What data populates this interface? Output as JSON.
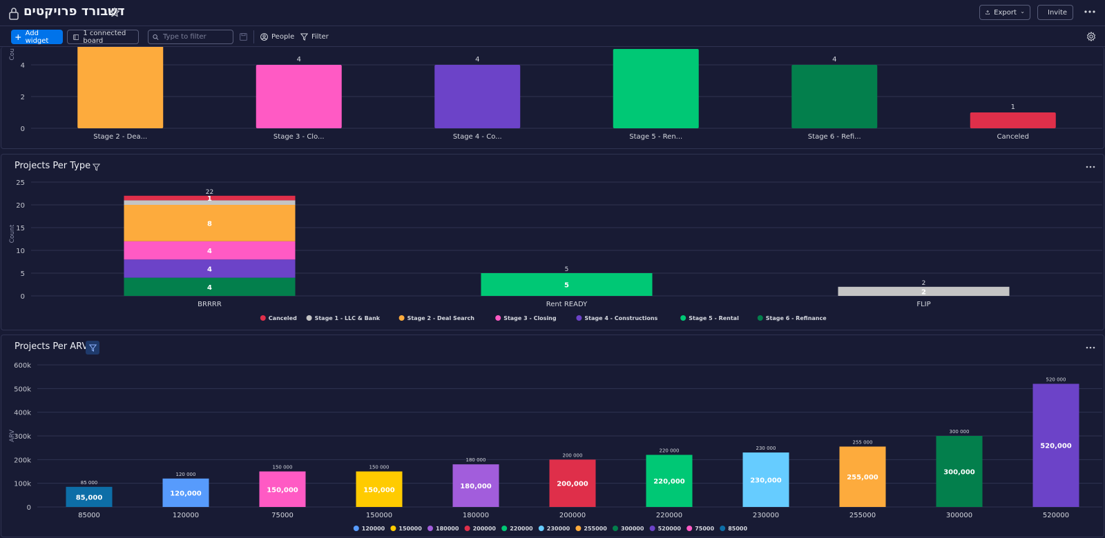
{
  "header": {
    "title": "דשבורד פרויקטים",
    "export_label": "Export",
    "invite_label": "Invite"
  },
  "toolbar": {
    "add_widget_label": "Add widget",
    "connected_board_label": "1 connected board",
    "filter_placeholder": "Type to filter",
    "people_label": "People",
    "filter_label": "Filter"
  },
  "colors": {
    "Stage 1 - LLC & Bank": "#c4c4c4",
    "Stage 2 - Deal Search": "#fdab3d",
    "Stage 3 - Closing": "#ff5ac4",
    "Stage 4 - Constructions": "#6c43c8",
    "Stage 5 - Rental": "#00c875",
    "Stage 6 - Refinance": "#037f4c",
    "Canceled": "#df2f4a"
  },
  "panels": {
    "per_type_title": "Projects Per Type",
    "per_arv_title": "Projects Per ARV"
  },
  "chart_data": [
    {
      "type": "bar",
      "ylabel": "Cou",
      "y_ticks": [
        0,
        2,
        4
      ],
      "categories": [
        "Stage 2 - Dea...",
        "Stage 3 - Clo...",
        "Stage 4 - Co...",
        "Stage 5 - Ren...",
        "Stage 6 - Refi...",
        "Canceled"
      ],
      "values": [
        6,
        4,
        4,
        5,
        4,
        1
      ],
      "value_labels": [
        "",
        "4",
        "4",
        "",
        "4",
        "1"
      ],
      "colors": [
        "#fdab3d",
        "#ff5ac4",
        "#6c43c8",
        "#00c875",
        "#037f4c",
        "#df2f4a"
      ]
    },
    {
      "type": "bar",
      "stacked": true,
      "ylabel": "Count",
      "ylim": [
        0,
        25
      ],
      "y_ticks": [
        0,
        5,
        10,
        15,
        20,
        25
      ],
      "categories": [
        "BRRRR",
        "Rent READY",
        "FLIP"
      ],
      "totals": [
        "22",
        "5",
        "2"
      ],
      "series": [
        {
          "name": "Stage 6 - Refinance",
          "color": "#037f4c",
          "values": [
            4,
            0,
            0
          ]
        },
        {
          "name": "Stage 4 - Constructions",
          "color": "#6c43c8",
          "values": [
            4,
            0,
            0
          ]
        },
        {
          "name": "Stage 3 - Closing",
          "color": "#ff5ac4",
          "values": [
            4,
            0,
            0
          ]
        },
        {
          "name": "Stage 2 - Deal Search",
          "color": "#fdab3d",
          "values": [
            8,
            0,
            0
          ]
        },
        {
          "name": "Stage 1 - LLC & Bank",
          "color": "#c4c4c4",
          "values": [
            1,
            0,
            2
          ]
        },
        {
          "name": "Canceled",
          "color": "#df2f4a",
          "values": [
            1,
            0,
            0
          ]
        },
        {
          "name": "Stage 5 - Rental",
          "color": "#00c875",
          "values": [
            0,
            5,
            0
          ]
        }
      ],
      "segment_labels": [
        [
          "4",
          "",
          ""
        ],
        [
          "4",
          "",
          ""
        ],
        [
          "4",
          "",
          ""
        ],
        [
          "8",
          "",
          ""
        ],
        [
          "",
          "",
          "2"
        ],
        [
          "1",
          "",
          ""
        ],
        [
          "",
          "5",
          ""
        ]
      ],
      "legend": [
        {
          "name": "Canceled",
          "color": "#df2f4a"
        },
        {
          "name": "Stage 1 - LLC & Bank",
          "color": "#c4c4c4"
        },
        {
          "name": "Stage 2 - Deal Search",
          "color": "#fdab3d"
        },
        {
          "name": "Stage 3 - Closing",
          "color": "#ff5ac4"
        },
        {
          "name": "Stage 4 - Constructions",
          "color": "#6c43c8"
        },
        {
          "name": "Stage 5 - Rental",
          "color": "#00c875"
        },
        {
          "name": "Stage 6 - Refinance",
          "color": "#037f4c"
        }
      ]
    },
    {
      "type": "bar",
      "ylabel": "ARV",
      "ylim": [
        0,
        600000
      ],
      "y_ticks": [
        0,
        100000,
        200000,
        300000,
        400000,
        500000,
        600000
      ],
      "y_tick_labels": [
        "0",
        "100k",
        "200k",
        "300k",
        "400k",
        "500k",
        "600k"
      ],
      "categories": [
        "85000",
        "120000",
        "75000",
        "150000",
        "180000",
        "200000",
        "220000",
        "230000",
        "255000",
        "300000",
        "520000"
      ],
      "values": [
        85000,
        120000,
        150000,
        150000,
        180000,
        200000,
        220000,
        230000,
        255000,
        300000,
        520000
      ],
      "value_labels": [
        "85,000",
        "120,000",
        "150,000",
        "150,000",
        "180,000",
        "200,000",
        "220,000",
        "230,000",
        "255,000",
        "300,000",
        "520,000"
      ],
      "top_labels": [
        "85 000",
        "120 000",
        "150 000",
        "150 000",
        "180 000",
        "200 000",
        "220 000",
        "230 000",
        "255 000",
        "300 000",
        "520 000"
      ],
      "colors": [
        "#0d6ea7",
        "#579bfc",
        "#ff5ac4",
        "#ffcb00",
        "#a25ddc",
        "#df2f4a",
        "#00c875",
        "#66ccff",
        "#fdab3d",
        "#037f4c",
        "#6c43c8"
      ],
      "legend": [
        {
          "name": "120000",
          "color": "#579bfc"
        },
        {
          "name": "150000",
          "color": "#ffcb00"
        },
        {
          "name": "180000",
          "color": "#a25ddc"
        },
        {
          "name": "200000",
          "color": "#df2f4a"
        },
        {
          "name": "220000",
          "color": "#00c875"
        },
        {
          "name": "230000",
          "color": "#66ccff"
        },
        {
          "name": "255000",
          "color": "#fdab3d"
        },
        {
          "name": "300000",
          "color": "#037f4c"
        },
        {
          "name": "520000",
          "color": "#6c43c8"
        },
        {
          "name": "75000",
          "color": "#ff5ac4"
        },
        {
          "name": "85000",
          "color": "#0d6ea7"
        }
      ]
    }
  ]
}
